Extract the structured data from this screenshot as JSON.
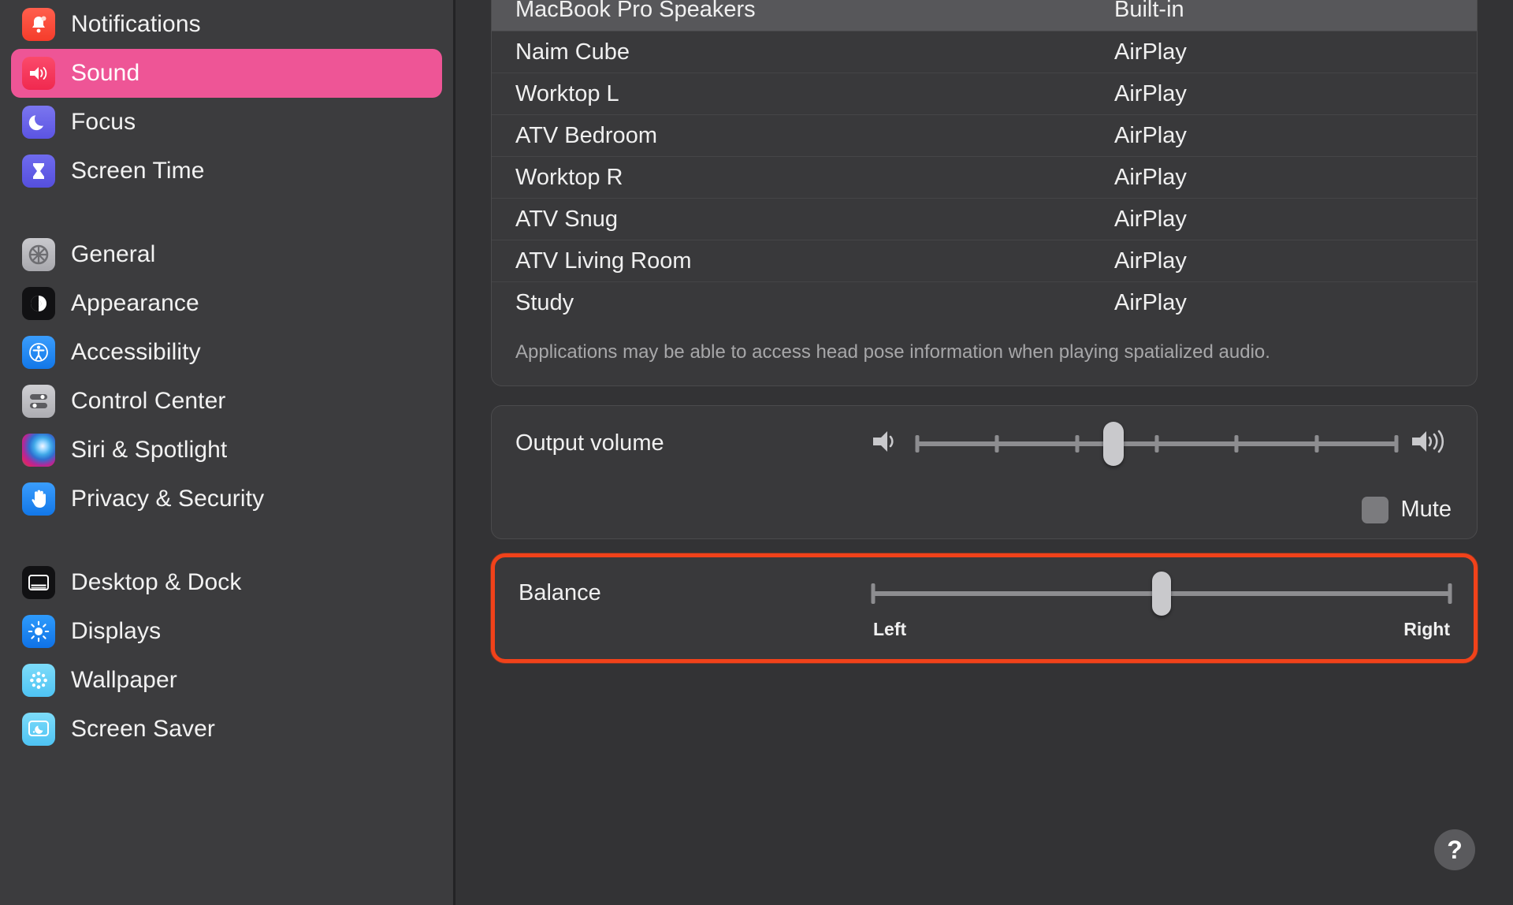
{
  "colors": {
    "sidebar_selected": "#ee5596",
    "highlight_box": "#f1421a",
    "content_bg": "#333335",
    "card_bg": "#39393b",
    "row_selected": "#57575a"
  },
  "sidebar": {
    "groups": [
      {
        "items": [
          {
            "label": "Notifications",
            "icon": "bell-icon",
            "icon_class": "ic-notifications",
            "selected": false
          },
          {
            "label": "Sound",
            "icon": "speaker-icon",
            "icon_class": "ic-sound",
            "selected": true
          },
          {
            "label": "Focus",
            "icon": "moon-icon",
            "icon_class": "ic-focus",
            "selected": false
          },
          {
            "label": "Screen Time",
            "icon": "hourglass-icon",
            "icon_class": "ic-screentime",
            "selected": false
          }
        ]
      },
      {
        "items": [
          {
            "label": "General",
            "icon": "gear-icon",
            "icon_class": "ic-general",
            "selected": false
          },
          {
            "label": "Appearance",
            "icon": "contrast-circle-icon",
            "icon_class": "ic-appearance",
            "selected": false
          },
          {
            "label": "Accessibility",
            "icon": "accessibility-person-icon",
            "icon_class": "ic-accessibility",
            "selected": false
          },
          {
            "label": "Control Center",
            "icon": "sliders-icon",
            "icon_class": "ic-controlcenter",
            "selected": false
          },
          {
            "label": "Siri & Spotlight",
            "icon": "siri-orb-icon",
            "icon_class": "ic-siri",
            "selected": false
          },
          {
            "label": "Privacy & Security",
            "icon": "hand-raised-icon",
            "icon_class": "ic-privacy",
            "selected": false
          }
        ]
      },
      {
        "items": [
          {
            "label": "Desktop & Dock",
            "icon": "desktop-dock-icon",
            "icon_class": "ic-desktopdock",
            "selected": false
          },
          {
            "label": "Displays",
            "icon": "brightness-sun-icon",
            "icon_class": "ic-displays",
            "selected": false
          },
          {
            "label": "Wallpaper",
            "icon": "wallpaper-flower-icon",
            "icon_class": "ic-wallpaper",
            "selected": false
          },
          {
            "label": "Screen Saver",
            "icon": "screen-saver-icon",
            "icon_class": "ic-screensaver",
            "selected": false
          }
        ]
      }
    ]
  },
  "main": {
    "device_list": {
      "rows": [
        {
          "name": "MacBook Pro Speakers",
          "kind": "Built-in",
          "selected": true
        },
        {
          "name": "Naim Cube",
          "kind": "AirPlay",
          "selected": false
        },
        {
          "name": "Worktop L",
          "kind": "AirPlay",
          "selected": false
        },
        {
          "name": "ATV Bedroom",
          "kind": "AirPlay",
          "selected": false
        },
        {
          "name": "Worktop R",
          "kind": "AirPlay",
          "selected": false
        },
        {
          "name": "ATV Snug",
          "kind": "AirPlay",
          "selected": false
        },
        {
          "name": "ATV Living Room",
          "kind": "AirPlay",
          "selected": false
        },
        {
          "name": "Study",
          "kind": "AirPlay",
          "selected": false
        }
      ],
      "note": "Applications may be able to access head pose information when playing spatialized audio."
    },
    "output_volume": {
      "label": "Output volume",
      "value_percent": 41,
      "tick_count": 7,
      "left_icon": "speaker-low-icon",
      "right_icon": "speaker-high-icon"
    },
    "mute": {
      "label": "Mute",
      "checked": false
    },
    "balance": {
      "label": "Balance",
      "value_percent": 50,
      "left_label": "Left",
      "right_label": "Right",
      "highlighted": true
    },
    "help": {
      "glyph": "?"
    }
  }
}
